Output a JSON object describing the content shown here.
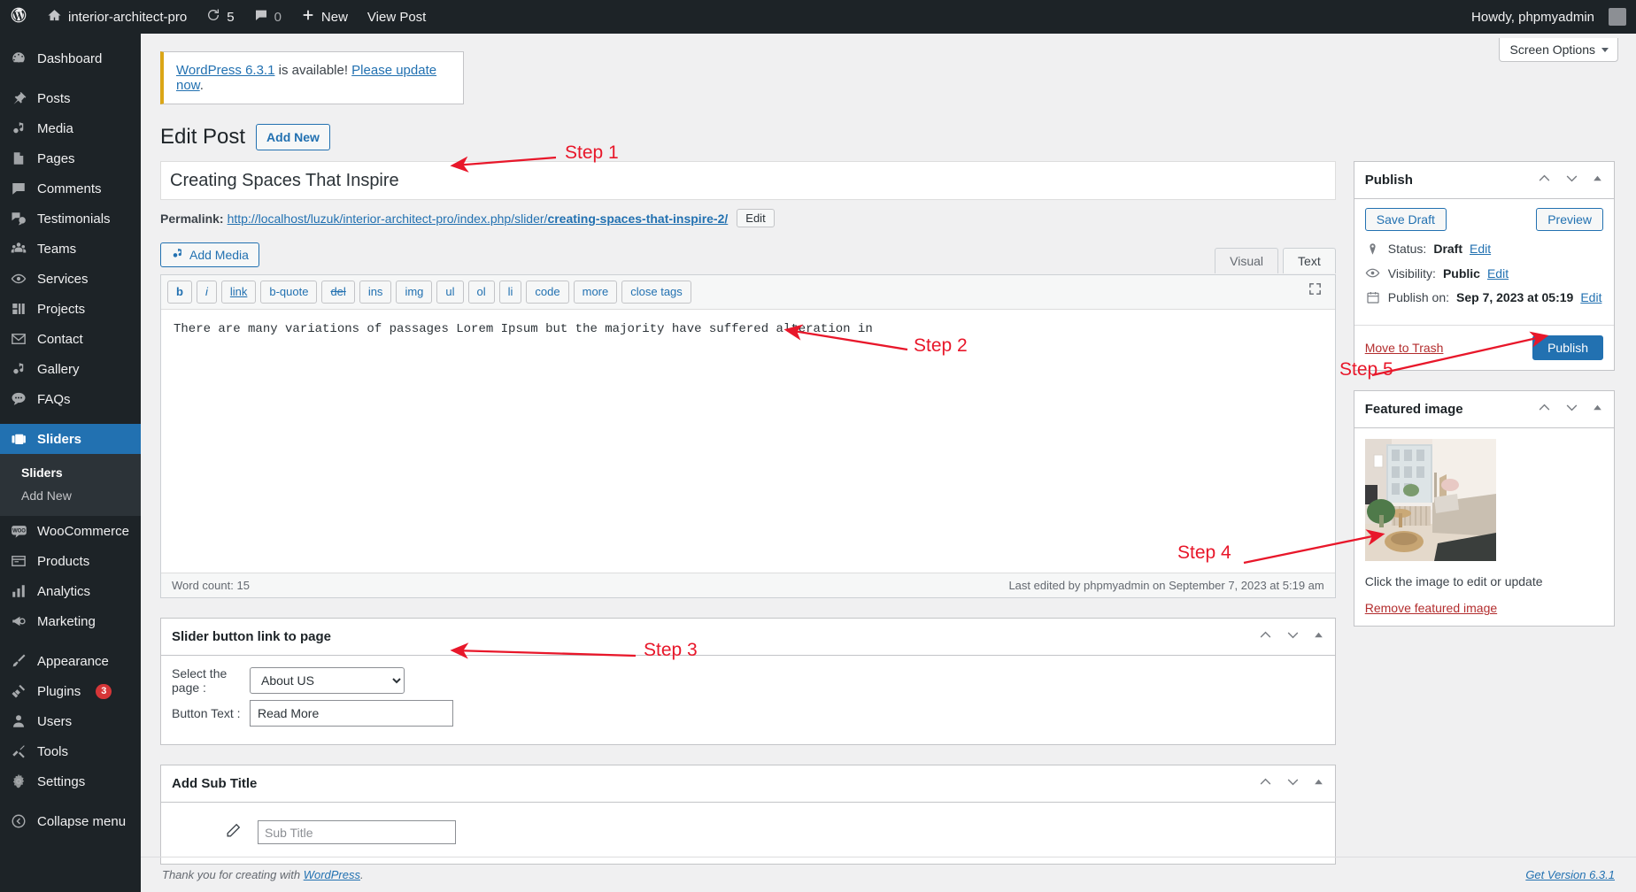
{
  "adminbar": {
    "logo_icon": "wordpress-logo-icon",
    "site_icon": "home-icon",
    "site_name": "interior-architect-pro",
    "updates_icon": "updates-icon",
    "updates_count": "5",
    "comments_icon": "comment-bubble-icon",
    "comments_count": "0",
    "new_icon": "plus-icon",
    "new_label": "New",
    "view_post_label": "View Post",
    "howdy": "Howdy, phpmyadmin",
    "avatar_icon": "avatar-icon"
  },
  "sidebar": {
    "items": [
      {
        "label": "Dashboard",
        "icon": "dashboard-icon"
      },
      {
        "label": "Posts",
        "icon": "pin-icon"
      },
      {
        "label": "Media",
        "icon": "media-icon"
      },
      {
        "label": "Pages",
        "icon": "pages-icon"
      },
      {
        "label": "Comments",
        "icon": "comment-bubble-icon"
      },
      {
        "label": "Testimonials",
        "icon": "testimonials-icon"
      },
      {
        "label": "Teams",
        "icon": "teams-icon"
      },
      {
        "label": "Services",
        "icon": "services-eye-icon"
      },
      {
        "label": "Projects",
        "icon": "projects-icon"
      },
      {
        "label": "Contact",
        "icon": "envelope-icon"
      },
      {
        "label": "Gallery",
        "icon": "media-icon"
      },
      {
        "label": "FAQs",
        "icon": "faq-bubble-icon"
      },
      {
        "label": "Sliders",
        "icon": "sliders-icon",
        "current": true
      },
      {
        "label": "WooCommerce",
        "icon": "woocommerce-icon"
      },
      {
        "label": "Products",
        "icon": "products-icon"
      },
      {
        "label": "Analytics",
        "icon": "analytics-bars-icon"
      },
      {
        "label": "Marketing",
        "icon": "megaphone-icon"
      },
      {
        "label": "Appearance",
        "icon": "paintbrush-icon"
      },
      {
        "label": "Plugins",
        "icon": "plug-icon",
        "badge": "3"
      },
      {
        "label": "Users",
        "icon": "users-icon"
      },
      {
        "label": "Tools",
        "icon": "tools-icon"
      },
      {
        "label": "Settings",
        "icon": "settings-gear-icon"
      },
      {
        "label": "Collapse menu",
        "icon": "collapse-arrow-icon"
      }
    ],
    "submenu": [
      {
        "label": "Sliders",
        "current": true
      },
      {
        "label": "Add New",
        "current": false
      }
    ]
  },
  "screen_meta": {
    "screen_options_label": "Screen Options"
  },
  "notice": {
    "link1": "WordPress 6.3.1",
    "mid": " is available! ",
    "link2": "Please update now",
    "end": "."
  },
  "page": {
    "title": "Edit Post",
    "add_new_label": "Add New"
  },
  "post": {
    "title_value": "Creating Spaces That Inspire",
    "permalink_label": "Permalink:",
    "permalink_base": "http://localhost/luzuk/interior-architect-pro/index.php/slider/",
    "permalink_slug": "creating-spaces-that-inspire-2/",
    "permalink_edit_label": "Edit",
    "add_media_label": "Add Media",
    "editor_tabs": [
      {
        "label": "Visual",
        "active": false
      },
      {
        "label": "Text",
        "active": true
      }
    ],
    "quicktags": [
      "b",
      "i",
      "link",
      "b-quote",
      "del",
      "ins",
      "img",
      "ul",
      "ol",
      "li",
      "code",
      "more",
      "close tags"
    ],
    "fullscreen_icon": "fullscreen-icon",
    "content": "There are many variations of passages Lorem Ipsum but the majority have suffered alteration in",
    "word_count_label": "Word count: 15",
    "last_edited": "Last edited by phpmyadmin on September 7, 2023 at 5:19 am"
  },
  "metaboxes": [
    {
      "title": "Slider button link to page",
      "select_label": "Select the page :",
      "select_value": "About US",
      "select_options": [
        "About US"
      ],
      "button_text_label": "Button Text :",
      "button_text_value": "Read More"
    },
    {
      "title": "Add Sub Title",
      "pencil_icon": "pencil-icon",
      "subtitle_placeholder": "Sub Title"
    }
  ],
  "publish_box": {
    "title": "Publish",
    "save_draft_label": "Save Draft",
    "preview_label": "Preview",
    "status_icon": "pin-marker-icon",
    "status_label": "Status:",
    "status_value": "Draft",
    "status_edit": "Edit",
    "visibility_icon": "eye-icon",
    "visibility_label": "Visibility:",
    "visibility_value": "Public",
    "visibility_edit": "Edit",
    "publish_on_icon": "calendar-icon",
    "publish_on_label": "Publish on:",
    "publish_on_value": "Sep 7, 2023 at 05:19",
    "publish_on_edit": "Edit",
    "trash_label": "Move to Trash",
    "publish_label": "Publish"
  },
  "featured_image_box": {
    "title": "Featured image",
    "caption": "Click the image to edit or update",
    "remove_label": "Remove featured image"
  },
  "footer": {
    "thanks_prefix": "Thank you for creating with ",
    "thanks_link": "WordPress",
    "thanks_suffix": ".",
    "version_label": "Get Version 6.3.1"
  },
  "annotations": [
    {
      "label": "Step 1"
    },
    {
      "label": "Step 2"
    },
    {
      "label": "Step 3"
    },
    {
      "label": "Step 4"
    },
    {
      "label": "Step 5"
    }
  ],
  "colors": {
    "accent": "#2271b1",
    "sidebar_bg": "#1d2327",
    "current_menu": "#2271b1",
    "annotation_red": "#e8172a",
    "notice_accent": "#dba617",
    "badge_red": "#d63638"
  }
}
